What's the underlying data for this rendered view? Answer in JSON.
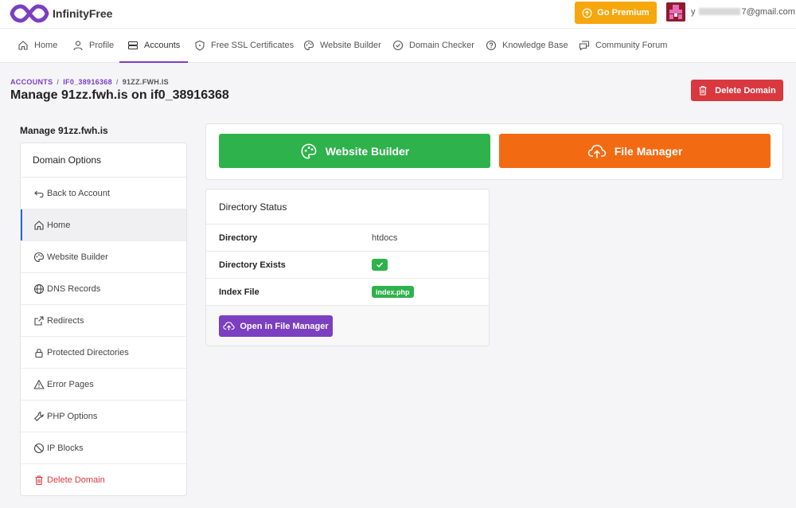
{
  "header": {
    "brand": "InfinityFree",
    "premium_label": "Go Premium",
    "email_prefix": "y",
    "email_suffix": "7@gmail.com"
  },
  "nav": {
    "items": [
      {
        "label": "Home",
        "icon": "home-icon"
      },
      {
        "label": "Profile",
        "icon": "user-icon"
      },
      {
        "label": "Accounts",
        "icon": "server-icon",
        "active": true
      },
      {
        "label": "Free SSL Certificates",
        "icon": "shield-icon"
      },
      {
        "label": "Website Builder",
        "icon": "palette-icon"
      },
      {
        "label": "Domain Checker",
        "icon": "check-circle-icon"
      },
      {
        "label": "Knowledge Base",
        "icon": "question-circle-icon"
      },
      {
        "label": "Community Forum",
        "icon": "chat-icon"
      }
    ]
  },
  "breadcrumb": {
    "accounts": "ACCOUNTS",
    "account": "IF0_38916368",
    "current": "91ZZ.FWH.IS",
    "separator": "/"
  },
  "page": {
    "title": "Manage 91zz.fwh.is on if0_38916368",
    "delete_label": "Delete Domain"
  },
  "sidebar": {
    "heading": "Manage 91zz.fwh.is",
    "title": "Domain Options",
    "items": [
      {
        "label": "Back to Account",
        "icon": "back-arrow-icon"
      },
      {
        "label": "Home",
        "icon": "home-icon",
        "active": true
      },
      {
        "label": "Website Builder",
        "icon": "palette-icon"
      },
      {
        "label": "DNS Records",
        "icon": "globe-icon"
      },
      {
        "label": "Redirects",
        "icon": "external-link-icon"
      },
      {
        "label": "Protected Directories",
        "icon": "lock-icon"
      },
      {
        "label": "Error Pages",
        "icon": "warning-icon"
      },
      {
        "label": "PHP Options",
        "icon": "wrench-icon"
      },
      {
        "label": "IP Blocks",
        "icon": "ban-icon"
      },
      {
        "label": "Delete Domain",
        "icon": "trash-icon",
        "danger": true
      }
    ]
  },
  "actions": {
    "website_builder": "Website Builder",
    "file_manager": "File Manager"
  },
  "directory": {
    "title": "Directory Status",
    "rows": [
      {
        "label": "Directory",
        "value": "htdocs"
      },
      {
        "label": "Directory Exists",
        "value": "yes"
      },
      {
        "label": "Index File",
        "value": "index.php"
      }
    ],
    "open_button": "Open in File Manager"
  },
  "colors": {
    "accent": "#7b3fc0",
    "premium": "#f5a70d",
    "danger": "#d9383f",
    "success": "#2eb24b",
    "file_manager": "#f26a12"
  }
}
